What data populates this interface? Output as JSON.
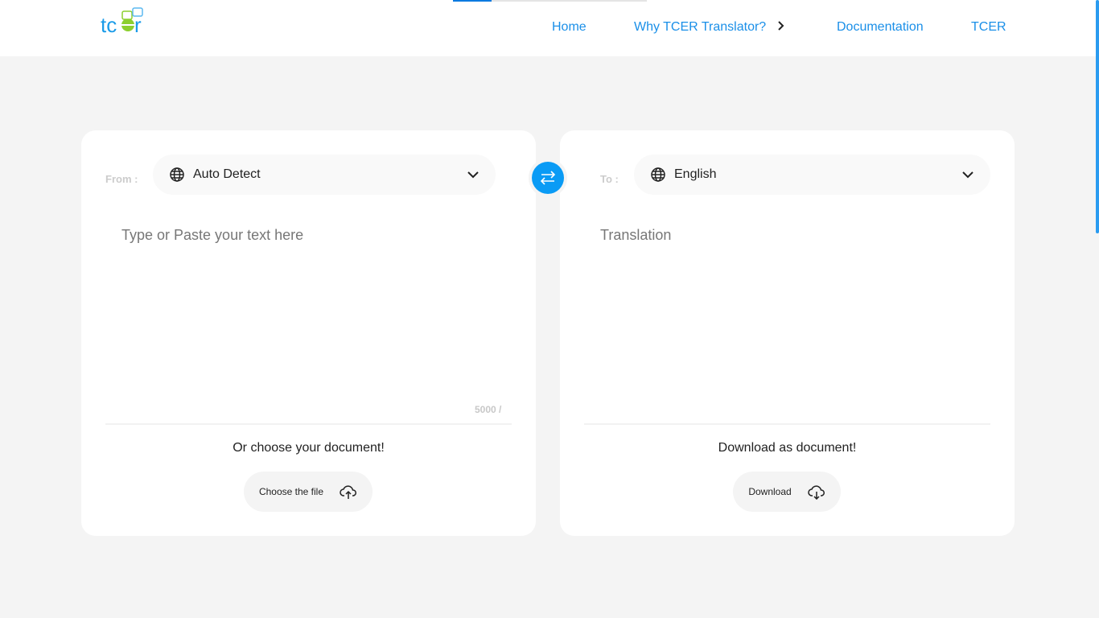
{
  "header": {
    "logo_text": "tcer",
    "progress_percent": 20,
    "nav": [
      {
        "label": "Home"
      },
      {
        "label": "Why TCER Translator?"
      },
      {
        "label": "Documentation"
      },
      {
        "label": "TCER"
      }
    ]
  },
  "source": {
    "label": "From :",
    "language": "Auto Detect",
    "placeholder": "Type or Paste your text here",
    "counter": "5000 /",
    "doc_prompt": "Or choose your document!",
    "button": "Choose the file"
  },
  "target": {
    "label": "To :",
    "language": "English",
    "placeholder": "Translation",
    "doc_prompt": "Download as document!",
    "button": "Download"
  },
  "colors": {
    "accent": "#0a9bf5",
    "nav": "#1a8fe8"
  }
}
